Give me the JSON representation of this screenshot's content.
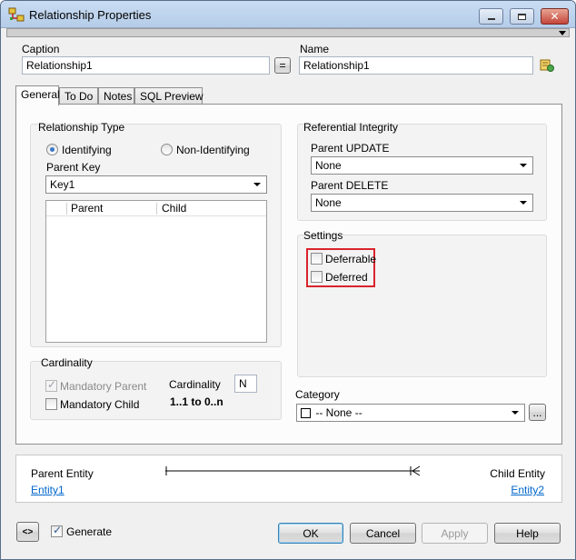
{
  "window": {
    "title": "Relationship Properties"
  },
  "caption": {
    "label": "Caption",
    "value": "Relationship1"
  },
  "equals_button": {
    "label": "="
  },
  "name": {
    "label": "Name",
    "value": "Relationship1"
  },
  "tabs": [
    {
      "label": "General",
      "active": true
    },
    {
      "label": "To Do"
    },
    {
      "label": "Notes"
    },
    {
      "label": "SQL Preview"
    }
  ],
  "relationship_type": {
    "title": "Relationship Type",
    "identifying": "Identifying",
    "non_identifying": "Non-Identifying",
    "selected": "Identifying",
    "parent_key_label": "Parent Key",
    "parent_key_value": "Key1",
    "columns": [
      "Parent",
      "Child"
    ]
  },
  "referential_integrity": {
    "title": "Referential Integrity",
    "parent_update_label": "Parent UPDATE",
    "parent_update_value": "None",
    "parent_delete_label": "Parent DELETE",
    "parent_delete_value": "None"
  },
  "settings": {
    "title": "Settings",
    "deferrable": "Deferrable",
    "deferred": "Deferred"
  },
  "cardinality": {
    "title": "Cardinality",
    "mandatory_parent": "Mandatory Parent",
    "mandatory_child": "Mandatory Child",
    "cardinality_label": "Cardinality",
    "cardinality_value": "N",
    "cardinality_text": "1..1 to 0..n"
  },
  "category": {
    "label": "Category",
    "value": "-- None --",
    "browse": "..."
  },
  "diagram": {
    "parent_label": "Parent Entity",
    "parent_link": "Entity1",
    "child_label": "Child Entity",
    "child_link": "Entity2"
  },
  "footer": {
    "generate": "Generate",
    "ok": "OK",
    "cancel": "Cancel",
    "apply": "Apply",
    "help": "Help"
  },
  "colors": {
    "highlight": "#d9242b",
    "link": "#0066cc",
    "titlebar": "#c9dcf2"
  },
  "icons": [
    "app-relationship-icon",
    "minimize-icon",
    "maximize-icon",
    "close-icon",
    "name-lookup-icon",
    "swap-icon"
  ]
}
